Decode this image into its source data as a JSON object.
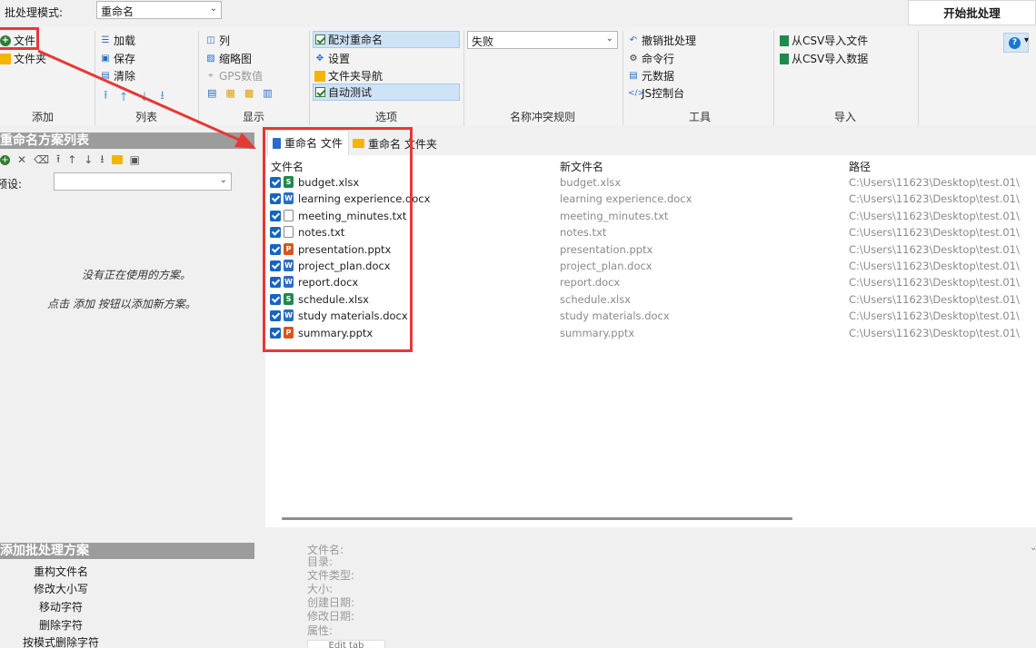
{
  "topbar": {
    "mode_label": "批处理模式:",
    "mode_value": "重命名",
    "start_button": "开始批处理"
  },
  "ribbon": {
    "add": {
      "file": "文件",
      "folder": "文件夹",
      "group_label": "添加"
    },
    "list": {
      "load": "加载",
      "save": "保存",
      "clear": "清除",
      "group_label": "列表"
    },
    "display": {
      "columns": "列",
      "thumbnails": "缩略图",
      "gps": "GPS数值",
      "group_label": "显示"
    },
    "options": {
      "pair_rename": "配对重命名",
      "settings": "设置",
      "folder_nav": "文件夹导航",
      "auto_test": "自动测试",
      "group_label": "选项"
    },
    "conflict": {
      "value": "失败",
      "group_label": "名称冲突规则"
    },
    "tools": {
      "undo": "撤销批处理",
      "cmd": "命令行",
      "metadata": "元数据",
      "js_console": "JS控制台",
      "group_label": "工具"
    },
    "import": {
      "csv_file": "从CSV导入文件",
      "csv_data": "从CSV导入数据",
      "group_label": "导入"
    }
  },
  "left": {
    "scheme_header": "重命名方案列表",
    "preset_label": "预设:",
    "empty_line1": "没有正在使用的方案。",
    "empty_line2": "点击 添加 按钮以添加新方案。",
    "batch_header": "添加批处理方案",
    "batch_items": [
      "重构文件名",
      "修改大小写",
      "移动字符",
      "删除字符",
      "按模式删除字符"
    ]
  },
  "tabs": {
    "file_tab": "重命名 文件",
    "folder_tab": "重命名 文件夹"
  },
  "grid": {
    "headers": {
      "name": "文件名",
      "new_name": "新文件名",
      "path": "路径"
    },
    "rows": [
      {
        "name": "budget.xlsx",
        "new_name": "budget.xlsx",
        "path": "C:\\Users\\11623\\Desktop\\test.01\\",
        "type": "xlsx"
      },
      {
        "name": "learning experience.docx",
        "new_name": "learning experience.docx",
        "path": "C:\\Users\\11623\\Desktop\\test.01\\",
        "type": "docx"
      },
      {
        "name": "meeting_minutes.txt",
        "new_name": "meeting_minutes.txt",
        "path": "C:\\Users\\11623\\Desktop\\test.01\\",
        "type": "txt"
      },
      {
        "name": "notes.txt",
        "new_name": "notes.txt",
        "path": "C:\\Users\\11623\\Desktop\\test.01\\",
        "type": "txt"
      },
      {
        "name": "presentation.pptx",
        "new_name": "presentation.pptx",
        "path": "C:\\Users\\11623\\Desktop\\test.01\\",
        "type": "pptx"
      },
      {
        "name": "project_plan.docx",
        "new_name": "project_plan.docx",
        "path": "C:\\Users\\11623\\Desktop\\test.01\\",
        "type": "docx"
      },
      {
        "name": "report.docx",
        "new_name": "report.docx",
        "path": "C:\\Users\\11623\\Desktop\\test.01\\",
        "type": "docx"
      },
      {
        "name": "schedule.xlsx",
        "new_name": "schedule.xlsx",
        "path": "C:\\Users\\11623\\Desktop\\test.01\\",
        "type": "xlsx"
      },
      {
        "name": "study materials.docx",
        "new_name": "study materials.docx",
        "path": "C:\\Users\\11623\\Desktop\\test.01\\",
        "type": "docx"
      },
      {
        "name": "summary.pptx",
        "new_name": "summary.pptx",
        "path": "C:\\Users\\11623\\Desktop\\test.01\\",
        "type": "pptx"
      }
    ]
  },
  "details": {
    "filename": "文件名:",
    "directory": "目录:",
    "filetype": "文件类型:",
    "size": "大小:",
    "created": "创建日期:",
    "modified": "修改日期:",
    "attributes": "属性:",
    "edit_button": "Edit tab"
  },
  "colors": {
    "annotation": "#e53935",
    "accent": "#1565c0",
    "highlight": "#cfe3f7"
  }
}
